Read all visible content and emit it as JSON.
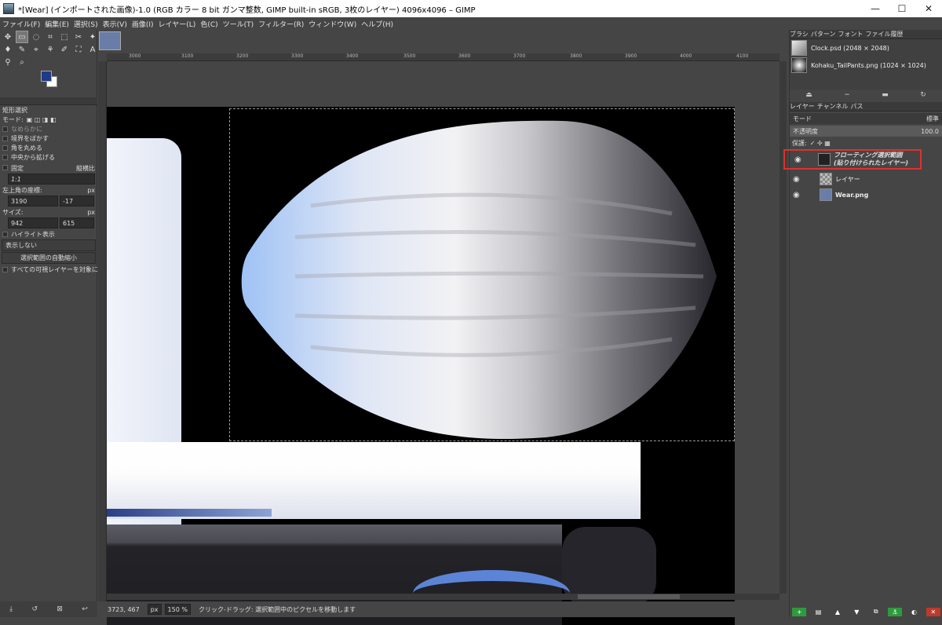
{
  "window": {
    "title": "*[Wear] (インポートされた画像)-1.0 (RGB カラー 8 bit ガンマ整数, GIMP built-in sRGB, 3枚のレイヤー) 4096x4096 – GIMP",
    "min": "—",
    "max": "☐",
    "close": "✕"
  },
  "menu": [
    "ファイル(F)",
    "編集(E)",
    "選択(S)",
    "表示(V)",
    "画像(I)",
    "レイヤー(L)",
    "色(C)",
    "ツール(T)",
    "フィルター(R)",
    "ウィンドウ(W)",
    "ヘルプ(H)"
  ],
  "tools": {
    "icons": [
      "✥",
      "▭",
      "◌",
      "⌗",
      "⬚",
      "✂",
      "✦",
      "♦",
      "✎",
      "⌖",
      "⚘",
      "✐",
      "⛶",
      "A",
      "⚲",
      "⌕"
    ]
  },
  "options": {
    "title": "矩形選択",
    "mode_label": "モード:",
    "antialias": "なめらかに",
    "feather": "境界をぼかす",
    "rounded": "角を丸める",
    "expand": "中央から拡げる",
    "fixed": "固定",
    "fixed_value": "縦横比",
    "ratio": "1:1",
    "pos_label": "左上角の座標:",
    "pos_unit": "px",
    "pos_x": "3190",
    "pos_y": "-17",
    "size_label": "サイズ:",
    "size_unit": "px",
    "size_w": "942",
    "size_h": "615",
    "highlight": "ハイライト表示",
    "guides": "表示しない",
    "autoshrink": "選択範囲の自動縮小",
    "sample_merged": "すべての可視レイヤーを対象に"
  },
  "ruler": [
    "3000",
    "3100",
    "3200",
    "3300",
    "3400",
    "3500",
    "3600",
    "3700",
    "3800",
    "3900",
    "4000",
    "4100"
  ],
  "status": {
    "coords": "3723, 467",
    "unit": "px",
    "zoom": "150 %",
    "message": "クリック-ドラッグ: 選択範囲中のピクセルを移動します"
  },
  "right": {
    "tabs": [
      "ブラシ",
      "パターン",
      "フォント",
      "ファイル履歴"
    ],
    "history": [
      "Clock.psd (2048 × 2048)",
      "Kohaku_TailPants.png (1024 × 1024)"
    ],
    "layer_tabs": [
      "レイヤー",
      "チャンネル",
      "パス"
    ],
    "mode_label": "モード",
    "mode_value": "標準",
    "opacity_label": "不透明度",
    "opacity_value": "100.0",
    "lock_label": "保護:",
    "layers": [
      {
        "name_line1": "フローティング選択範囲",
        "name_line2": "(貼り付けられたレイヤー)"
      },
      {
        "name_line1": "レイヤー"
      },
      {
        "name_line1": "Wear.png"
      }
    ]
  },
  "colors": {
    "highlight_box": "#e03030",
    "fg": "#1e3a8a",
    "bg": "#ffffff"
  }
}
